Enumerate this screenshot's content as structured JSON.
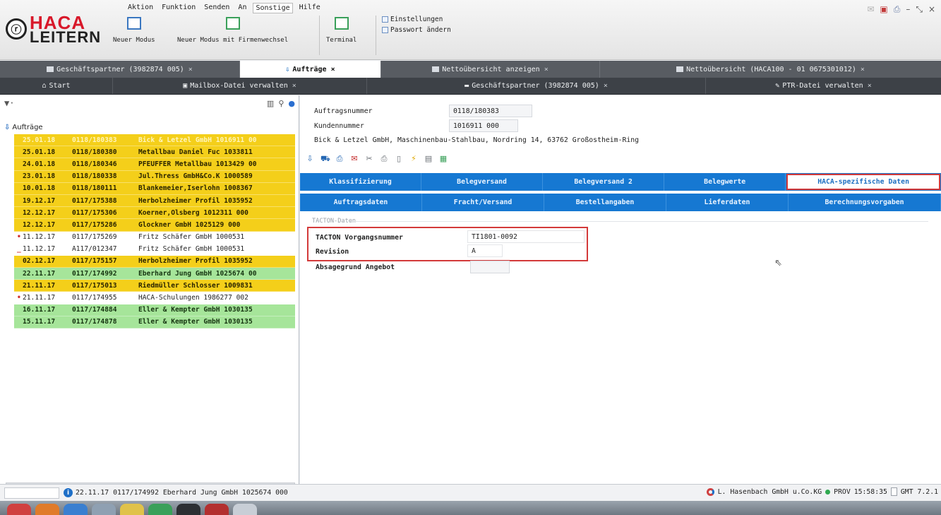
{
  "menu": [
    "Aktion",
    "Funktion",
    "Senden",
    "An",
    "Sonstige",
    "Hilfe"
  ],
  "logo": {
    "top": "HACA",
    "bottom": "LEITERN",
    "circle": "ⓡ"
  },
  "ribbon": {
    "buttons": [
      {
        "label": "Neuer Modus"
      },
      {
        "label": "Neuer Modus mit Firmenwechsel"
      },
      {
        "label": "Terminal"
      }
    ],
    "small": [
      "Einstellungen",
      "Passwort ändern"
    ]
  },
  "window_controls": [
    "✉",
    "▣",
    "⎙",
    "–",
    "⤡",
    "×"
  ],
  "tabs_row1": [
    {
      "label": "Geschäftspartner (3982874 005)",
      "close": "×",
      "active": false
    },
    {
      "label": "Aufträge",
      "close": "×",
      "active": true
    },
    {
      "label": "Nettoübersicht anzeigen",
      "close": "×",
      "active": false
    },
    {
      "label": "Nettoübersicht (HACA100 - 01 0675301012)",
      "close": "×",
      "active": false
    }
  ],
  "tabs_row2": [
    {
      "label": "Start",
      "icon": "⌂",
      "close": ""
    },
    {
      "label": "Mailbox-Datei verwalten",
      "icon": "▣",
      "close": "×"
    },
    {
      "label": "Geschäftspartner (3982874 005)",
      "icon": "▬",
      "close": "×"
    },
    {
      "label": "PTR-Datei verwalten",
      "icon": "✎",
      "close": "×"
    }
  ],
  "left": {
    "filter": "▼·",
    "tools": [
      "▥",
      "⚲",
      "●"
    ],
    "root": "Aufträge",
    "rows": [
      {
        "date": "25.01.18",
        "nr": "0118/180383",
        "text": "Bick & Letzel GmbH  1016911  00",
        "color": "yellow",
        "mark": "",
        "sel": true
      },
      {
        "date": "25.01.18",
        "nr": "0118/180380",
        "text": "Metallbau Daniel Fuc  1033811",
        "color": "yellow",
        "mark": "",
        "sel": false
      },
      {
        "date": "24.01.18",
        "nr": "0118/180346",
        "text": "PFEUFFER Metallbau  1013429  00",
        "color": "yellow",
        "mark": "",
        "sel": false
      },
      {
        "date": "23.01.18",
        "nr": "0118/180338",
        "text": "Jul.Thress GmbH&Co.K  1000589",
        "color": "yellow",
        "mark": "",
        "sel": false
      },
      {
        "date": "10.01.18",
        "nr": "0118/180111",
        "text": "Blankemeier,Iserlohn  1008367",
        "color": "yellow",
        "mark": "",
        "sel": false
      },
      {
        "date": "19.12.17",
        "nr": "0117/175388",
        "text": "Herbolzheimer Profil  1035952",
        "color": "yellow",
        "mark": "",
        "sel": false
      },
      {
        "date": "12.12.17",
        "nr": "0117/175306",
        "text": "Koerner,Olsberg  1012311  000",
        "color": "yellow",
        "mark": "",
        "sel": false
      },
      {
        "date": "12.12.17",
        "nr": "0117/175286",
        "text": "Glockner GmbH  1025129  000",
        "color": "yellow",
        "mark": "",
        "sel": false
      },
      {
        "date": "11.12.17",
        "nr": "0117/175269",
        "text": "Fritz Schäfer   GmbH  1000531",
        "color": "white",
        "mark": "•",
        "sel": false
      },
      {
        "date": "11.12.17",
        "nr": "A117/012347",
        "text": "Fritz Schäfer   GmbH  1000531",
        "color": "white",
        "mark": "_",
        "sel": false
      },
      {
        "date": "02.12.17",
        "nr": "0117/175157",
        "text": "Herbolzheimer Profil  1035952",
        "color": "yellow",
        "mark": "",
        "sel": false
      },
      {
        "date": "22.11.17",
        "nr": "0117/174992",
        "text": "Eberhard Jung GmbH  1025674  00",
        "color": "green",
        "mark": "",
        "sel": false
      },
      {
        "date": "21.11.17",
        "nr": "0117/175013",
        "text": "Riedmüller Schlosser  1009831",
        "color": "yellow",
        "mark": "",
        "sel": false
      },
      {
        "date": "21.11.17",
        "nr": "0117/174955",
        "text": "HACA-Schulungen  1986277  002",
        "color": "white",
        "mark": "•",
        "sel": false
      },
      {
        "date": "16.11.17",
        "nr": "0117/174884",
        "text": "Eller & Kempter GmbH  1030135",
        "color": "green",
        "mark": "",
        "sel": false
      },
      {
        "date": "15.11.17",
        "nr": "0117/174878",
        "text": "Eller & Kempter GmbH  1030135",
        "color": "green",
        "mark": "",
        "sel": false
      }
    ]
  },
  "detail": {
    "auftragsnummer_label": "Auftragsnummer",
    "auftragsnummer": "0118/180383",
    "kundennummer_label": "Kundennummer",
    "kundennummer": "1016911 000",
    "address": "Bick & Letzel GmbH, Maschinenbau-Stahlbau, Nordring 14, 63762 Großostheim-Ring",
    "tabs_row_a": [
      "Klassifizierung",
      "Belegversand",
      "Belegversand 2",
      "Belegwerte",
      "HACA-spezifische Daten"
    ],
    "tabs_row_b": [
      "Auftragsdaten",
      "Fracht/Versand",
      "Bestellangaben",
      "Lieferdaten",
      "Berechnungsvorgaben"
    ],
    "group_label": "TACTON-Daten",
    "tacton_label": "TACTON Vorgangsnummer",
    "tacton_value": "TI1801-0092",
    "revision_label": "Revision",
    "revision_value": "A",
    "absage_label": "Absagegrund Angebot",
    "absage_value": ""
  },
  "status": {
    "info_icon": "i",
    "text": "22.11.17  0117/174992  Eberhard Jung GmbH  1025674  000",
    "company": "L. Hasenbach GmbH u.Co.KG",
    "env": "PROV",
    "time": "15:58:35",
    "tz": "GMT 7.2.1"
  },
  "colors": {
    "accent": "#1678d2",
    "yellow_row": "#f4cf1a",
    "green_row": "#a6e59a",
    "highlight": "#d33a3a"
  }
}
